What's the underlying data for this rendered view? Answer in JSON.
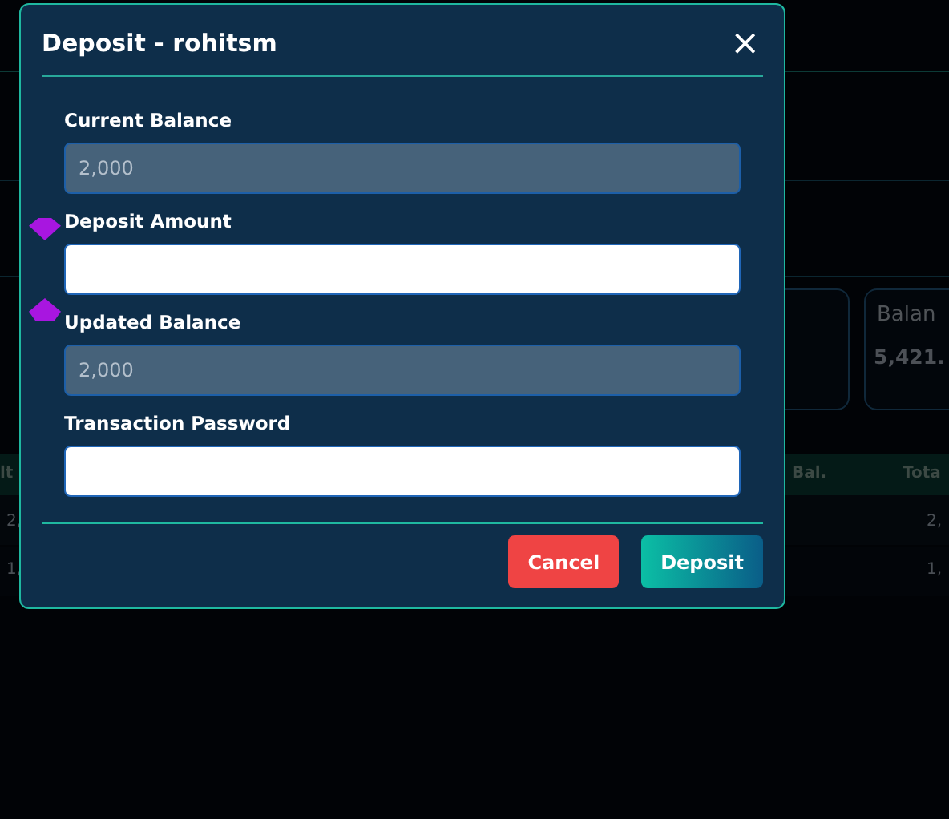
{
  "background": {
    "cards": [
      {
        "label": "Balan",
        "value": "5,421."
      }
    ],
    "table": {
      "columns": [
        "lt",
        "Bal.",
        "Tota"
      ],
      "rows": [
        [
          "2,",
          "2,"
        ],
        [
          "1,",
          "1,"
        ]
      ]
    }
  },
  "dialog": {
    "title": "Deposit - rohitsm",
    "close": "×",
    "fields": [
      {
        "label": "Current Balance",
        "value": "2,000",
        "disabled": true
      },
      {
        "label": "Deposit Amount",
        "disabled": false
      },
      {
        "label": "Updated Balance",
        "value": "2,000",
        "disabled": true
      },
      {
        "label": "Transaction Password",
        "disabled": false
      }
    ],
    "buttons": [
      {
        "label": "Cancel",
        "kind": "cancel"
      },
      {
        "label": "Deposit",
        "kind": "primary"
      }
    ]
  }
}
